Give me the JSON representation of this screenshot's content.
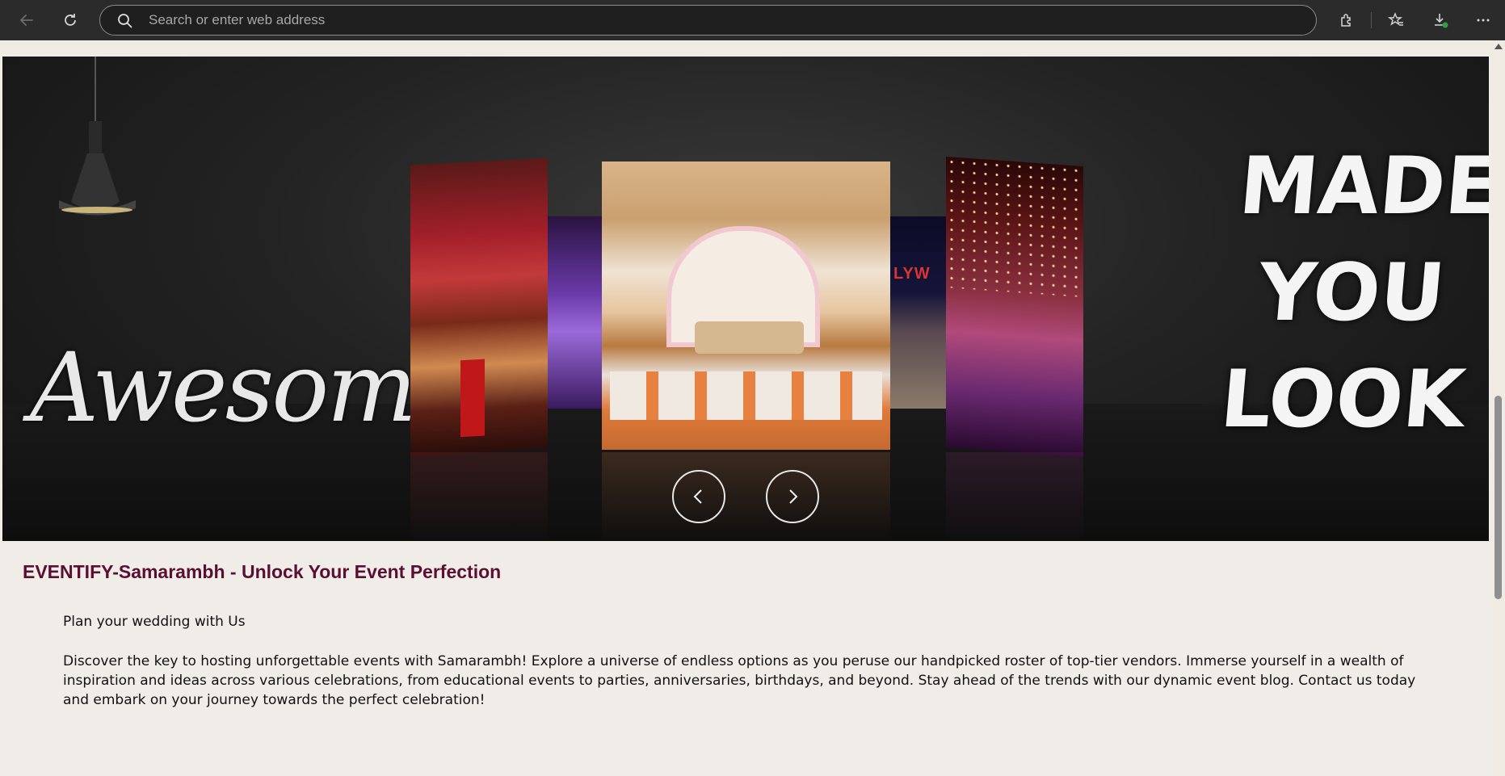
{
  "browser": {
    "address_placeholder": "Search or enter web address",
    "icons": [
      "back-arrow-icon",
      "refresh-icon",
      "search-icon",
      "extensions-icon",
      "favorites-icon",
      "downloads-icon",
      "more-icon"
    ]
  },
  "hero": {
    "left_word": "Awesome",
    "right_lines": [
      "MADE",
      "YOU",
      "LOOK"
    ],
    "panel_sign_text": "LYW",
    "prev_icon": "chevron-left-icon",
    "next_icon": "chevron-right-icon"
  },
  "content": {
    "heading": "EVENTIFY-Samarambh - Unlock Your Event Perfection",
    "subheading": "Plan your wedding with Us",
    "description": "Discover the key to hosting unforgettable events with Samarambh! Explore a universe of endless options as you peruse our handpicked roster of top-tier vendors. Immerse yourself in a wealth of inspiration and ideas across various celebrations, from educational events to parties, anniversaries, birthdays, and beyond. Stay ahead of the trends with our dynamic event blog. Contact us today and embark on your journey towards the perfect celebration!"
  },
  "colors": {
    "heading": "#5a0f30",
    "page_bg": "#f0ede8",
    "toolbar_bg": "#2b2b2b",
    "download_badge": "#2ea043"
  }
}
